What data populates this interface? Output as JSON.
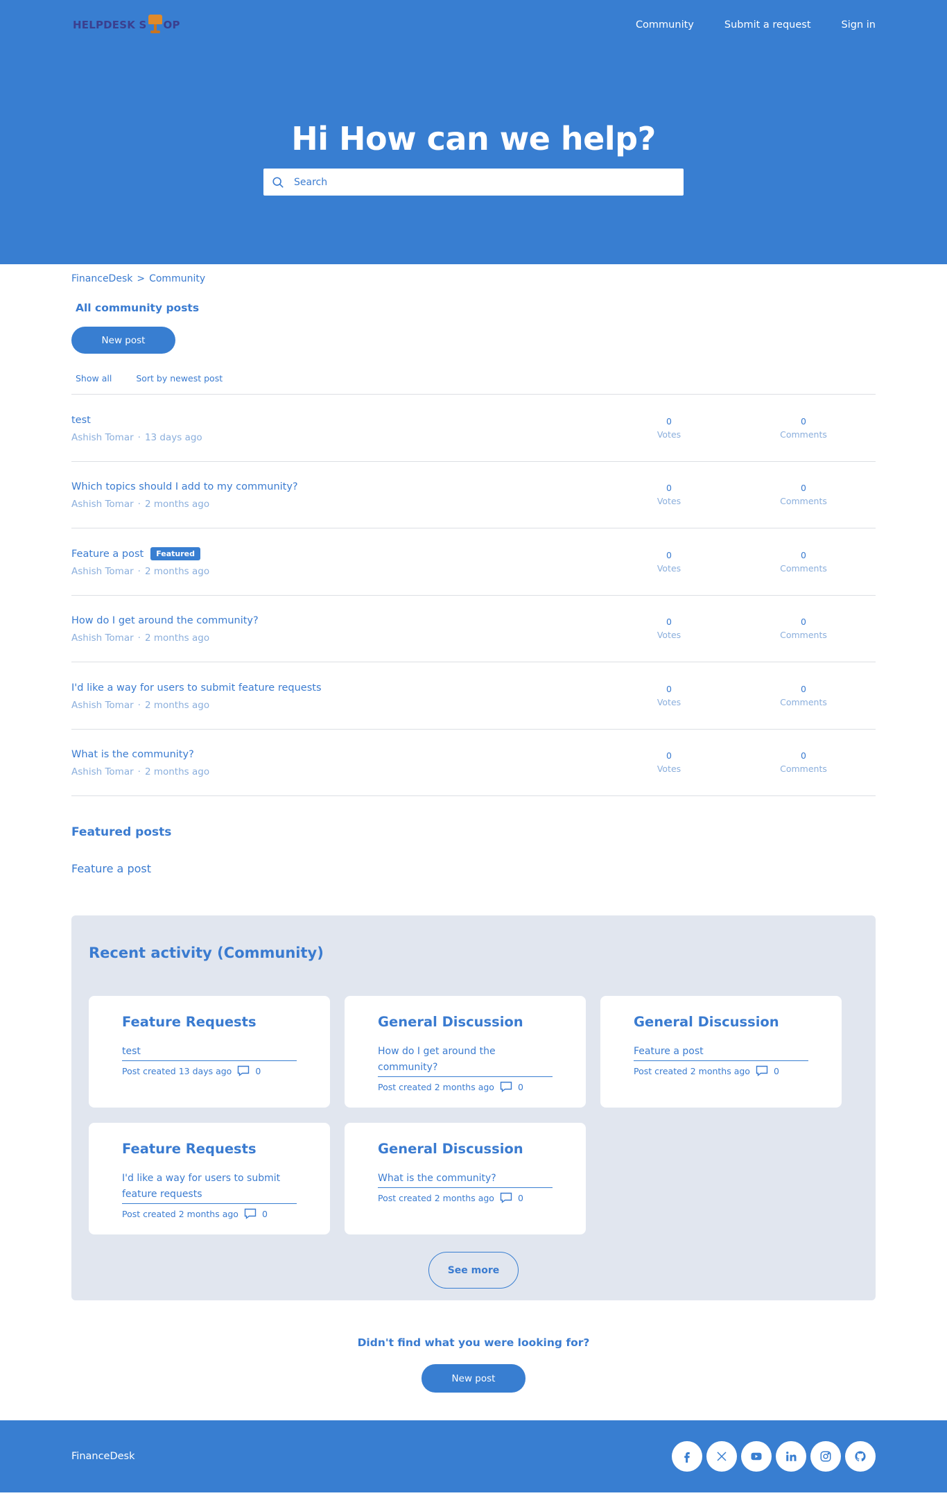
{
  "header": {
    "logo": {
      "part1": "HELPDESK S",
      "part2": "OP"
    },
    "nav": [
      "Community",
      "Submit a request",
      "Sign in"
    ]
  },
  "hero": {
    "title": "Hi How can we help?",
    "search_placeholder": "Search"
  },
  "breadcrumb": [
    "FinanceDesk",
    "Community"
  ],
  "breadcrumb_sep": ">",
  "page_title": "All community posts",
  "new_post_label": "New post",
  "filters": [
    "Show all",
    "Sort by newest post"
  ],
  "posts": [
    {
      "title": "test",
      "author": "Ashish Tomar",
      "time": "13 days ago",
      "votes": "0",
      "comments": "0",
      "featured": ""
    },
    {
      "title": "Which topics should I add to my community?",
      "author": "Ashish Tomar",
      "time": "2 months ago",
      "votes": "0",
      "comments": "0",
      "featured": ""
    },
    {
      "title": "Feature a post",
      "author": "Ashish Tomar",
      "time": "2 months ago",
      "votes": "0",
      "comments": "0",
      "featured": "Featured"
    },
    {
      "title": "How do I get around the community?",
      "author": "Ashish Tomar",
      "time": "2 months ago",
      "votes": "0",
      "comments": "0",
      "featured": ""
    },
    {
      "title": "I'd like a way for users to submit feature requests",
      "author": "Ashish Tomar",
      "time": "2 months ago",
      "votes": "0",
      "comments": "0",
      "featured": ""
    },
    {
      "title": "What is the community?",
      "author": "Ashish Tomar",
      "time": "2 months ago",
      "votes": "0",
      "comments": "0",
      "featured": ""
    }
  ],
  "stat_labels": {
    "votes": "Votes",
    "comments": "Comments"
  },
  "meta_sep": "·",
  "featured": {
    "title": "Featured posts",
    "items": [
      "Feature a post"
    ]
  },
  "activity": {
    "title": "Recent activity (Community)",
    "cards": [
      {
        "category": "Feature Requests",
        "title": "test",
        "meta": "Post created 13 days ago",
        "comments": "0"
      },
      {
        "category": "General Discussion",
        "title": "How do I get around the community?",
        "meta": "Post created 2 months ago",
        "comments": "0"
      },
      {
        "category": "General Discussion",
        "title": "Feature a post",
        "meta": "Post created 2 months ago",
        "comments": "0"
      },
      {
        "category": "Feature Requests",
        "title": "I'd like a way for users to submit feature requests",
        "meta": "Post created 2 months ago",
        "comments": "0"
      },
      {
        "category": "General Discussion",
        "title": "What is the community?",
        "meta": "Post created 2 months ago",
        "comments": "0"
      }
    ],
    "see_more": "See more"
  },
  "cta": {
    "question": "Didn't find what you were looking for?",
    "button": "New post"
  },
  "footer": {
    "brand": "FinanceDesk",
    "socials": [
      "facebook-icon",
      "x-icon",
      "youtube-icon",
      "linkedin-icon",
      "instagram-icon",
      "github-icon"
    ]
  },
  "colors": {
    "brand_blue": "#387ed1",
    "text_blue": "#3a7bd0",
    "muted_blue": "#8aaedc",
    "activity_bg": "#e1e6ef",
    "logo_orange": "#e08a2a",
    "logo_navy": "#3b3f8f"
  }
}
